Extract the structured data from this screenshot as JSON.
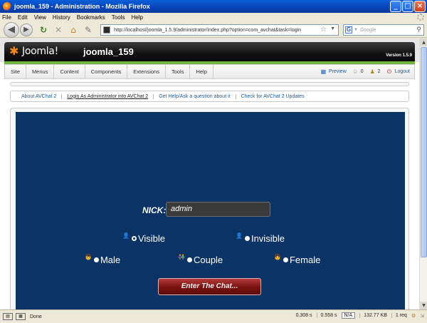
{
  "window": {
    "title": "joomla_159 - Administration - Mozilla Firefox",
    "buttons": [
      "_",
      "□",
      "×"
    ]
  },
  "menubar": [
    "File",
    "Edit",
    "View",
    "History",
    "Bookmarks",
    "Tools",
    "Help"
  ],
  "navbar": {
    "url": "http://localhost/joomla_1.5.9/administrator/index.php?option=com_avchat&task=login",
    "search_placeholder": "Google",
    "search_engine_letter": "G"
  },
  "joomla": {
    "logo": "Joomla!",
    "site_name": "joomla_159",
    "version": "Version 1.5.9"
  },
  "admin_menu": [
    "Site",
    "Menus",
    "Content",
    "Components",
    "Extensions",
    "Tools",
    "Help"
  ],
  "status": {
    "preview": "Preview",
    "messages": "0",
    "users": "2",
    "logout": "Logout"
  },
  "submenu": [
    {
      "label": "About AVChat 2",
      "active": false
    },
    {
      "label": "Login As Administrator into AVChat 2",
      "active": true
    },
    {
      "label": "Get Help/Ask a question about it",
      "active": false
    },
    {
      "label": "Check for AVChat 2 Updates",
      "active": false
    }
  ],
  "chat": {
    "nick_label": "NICK:",
    "nick_value": "admin",
    "visibility": {
      "visible": "Visible",
      "invisible": "Invisible",
      "selected": "Visible"
    },
    "gender": {
      "male": "Male",
      "couple": "Couple",
      "female": "Female"
    },
    "enter_button": "Enter The Chat..."
  },
  "statusbar": {
    "text": "Done",
    "time1": "0.308 s",
    "time2": "0.558 s",
    "na": "N/A",
    "size": "132.77 KB",
    "requests": "1 req"
  },
  "colors": {
    "chat_bg": "#0c3366",
    "joomla_green": "#6fb43f",
    "link": "#1a5c9a"
  }
}
